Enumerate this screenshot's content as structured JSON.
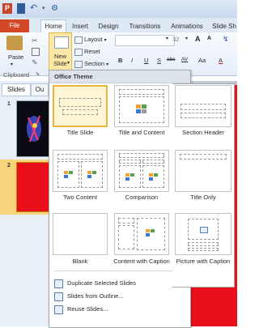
{
  "quick_access": {
    "app_icon_letter": "P"
  },
  "tabs": [
    "File",
    "Home",
    "Insert",
    "Design",
    "Transitions",
    "Animations",
    "Slide Sh"
  ],
  "ribbon": {
    "paste_label": "Paste",
    "new_slide_label1": "New",
    "new_slide_label2": "Slide",
    "layout_label": "Layout",
    "reset_label": "Reset",
    "section_label": "Section",
    "clipboard_label": "Clipboard",
    "font_size": "32",
    "font_buttons": [
      "B",
      "I",
      "U",
      "S",
      "abc",
      "AV",
      "Aa",
      "A"
    ]
  },
  "left_pane": {
    "tab_slides": "Slides",
    "tab_outline": "Ou",
    "thumb1_num": "1",
    "thumb2_num": "2"
  },
  "gallery": {
    "header": "Office Theme",
    "layouts": [
      "Title Slide",
      "Title and Content",
      "Section Header",
      "Two Content",
      "Comparison",
      "Title Only",
      "Blank",
      "Content with Caption",
      "Picture with Caption"
    ],
    "menu": [
      "Duplicate Selected Slides",
      "Slides from Outline...",
      "Reuse Slides..."
    ]
  },
  "colors": {
    "accent_red": "#e8101a",
    "file_tab": "#d24726",
    "selection": "#e9b43a"
  }
}
